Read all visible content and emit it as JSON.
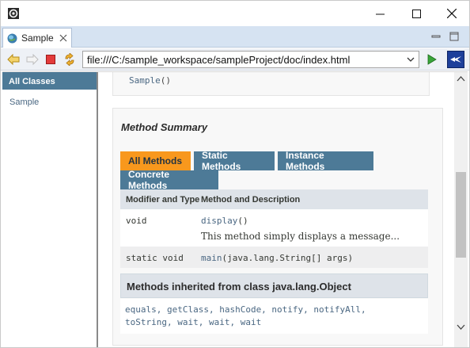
{
  "tab": {
    "label": "Sample"
  },
  "toolbar": {
    "url": "file:///C:/sample_workspace/sampleProject/doc/index.html"
  },
  "left_frame": {
    "header": "All Classes",
    "classes": [
      "Sample"
    ]
  },
  "constructor": {
    "name": "Sample",
    "parens": "()"
  },
  "method_summary": {
    "title": "Method Summary",
    "tabs": [
      {
        "label": "All Methods",
        "active": true
      },
      {
        "label": "Static Methods",
        "active": false
      },
      {
        "label": "Instance Methods",
        "active": false
      },
      {
        "label": "Concrete Methods",
        "active": false
      }
    ],
    "columns": [
      "Modifier and Type",
      "Method and Description"
    ],
    "rows": [
      {
        "modifier": "void",
        "method": "display",
        "args": "()",
        "description": "This method simply displays a message..."
      },
      {
        "modifier": "static void",
        "method": "main",
        "args": "(java.lang.String[] args)",
        "description": ""
      }
    ]
  },
  "inherited": {
    "title": "Methods inherited from class java.lang.Object",
    "line1": "equals, getClass, hashCode, notify, notifyAll,",
    "line2": "toString, wait, wait, wait"
  },
  "colors": {
    "tab_active": "#f8981d",
    "tab_inactive": "#4d7a97",
    "header_bg": "#dee3e9",
    "link": "#4a6782"
  }
}
